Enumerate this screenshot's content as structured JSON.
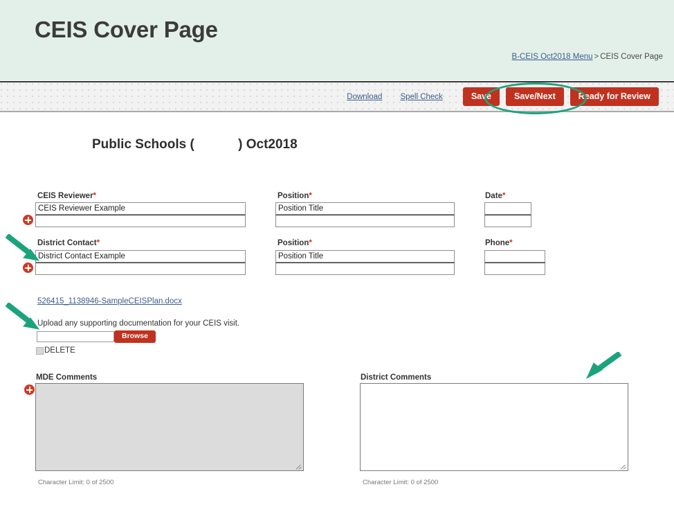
{
  "header": {
    "title": "CEIS Cover Page",
    "breadcrumb": {
      "link": "B-CEIS Oct2018 Menu",
      "separator": ">",
      "current": "CEIS Cover Page"
    },
    "background_color": "#e3f0ea"
  },
  "toolbar": {
    "download_label": "Download",
    "spell_check_label": "Spell Check",
    "save_label": "Save",
    "save_next_label": "Save/Next",
    "ready_for_review_label": "Ready for Review",
    "button_color": "#c0321f"
  },
  "annotations": {
    "highlight_color": "#1fa37f",
    "ellipse_target": "save-and-save-next-buttons",
    "arrows": [
      {
        "name": "arrow-district-contact",
        "points_to": "district-contact-input"
      },
      {
        "name": "arrow-upload",
        "points_to": "upload-documentation-text"
      },
      {
        "name": "arrow-district-comments",
        "points_to": "district-comments-textarea"
      }
    ]
  },
  "form": {
    "school_title": "Public Schools (            ) Oct2018",
    "row1": {
      "reviewer_label": "CEIS Reviewer",
      "reviewer_required": "*",
      "reviewer_value": "CEIS Reviewer Example",
      "reviewer_value2": "",
      "position_label": "Position",
      "position_required": "*",
      "position_value": "Position Title",
      "position_value2": "",
      "date_label": "Date",
      "date_required": "*",
      "date_value": "",
      "date_value2": ""
    },
    "row2": {
      "contact_label": "District Contact",
      "contact_required": "*",
      "contact_value": "District Contact Example",
      "contact_value2": "",
      "position_label": "Position",
      "position_required": "*",
      "position_value": "Position Title",
      "position_value2": "",
      "phone_label": "Phone",
      "phone_required": "*",
      "phone_value": "",
      "phone_value2": ""
    }
  },
  "file_section": {
    "attached_file": "526415_1138946-SampleCEISPlan.docx",
    "upload_instruction": "Upload any supporting documentation for your CEIS visit.",
    "file_input_value": "",
    "browse_label": "Browse",
    "delete_label": "DELETE",
    "delete_checked": false
  },
  "comments": {
    "mde": {
      "label": "MDE Comments",
      "value": "",
      "disabled": true,
      "char_limit": "Character Limit: 0 of 2500"
    },
    "district": {
      "label": "District Comments",
      "value": "",
      "disabled": false,
      "char_limit": "Character Limit: 0 of 2500"
    }
  }
}
